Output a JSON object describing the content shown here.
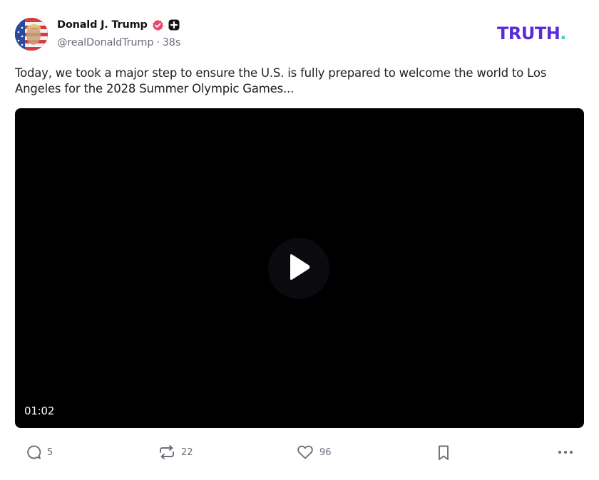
{
  "post": {
    "author": {
      "display_name": "Donald J. Trump",
      "handle": "@realDonaldTrump",
      "time_ago": "38s",
      "separator": "·"
    },
    "brand": {
      "logo_text": "TRUTH",
      "logo_dot": ".",
      "colors": {
        "primary": "#5a2bd6",
        "accent": "#3fd0c9"
      }
    },
    "text": "Today, we took a major step to ensure the U.S. is fully prepared to welcome the world to Los Angeles for the 2028 Summer Olympic Games...",
    "video": {
      "duration": "01:02",
      "play_icon": "play-icon"
    },
    "actions": {
      "replies": "5",
      "retruths": "22",
      "likes": "96"
    },
    "icons": {
      "verified": "verified-badge-icon",
      "plus": "plus-badge-icon",
      "reply": "comment-icon",
      "retruth": "repost-icon",
      "like": "heart-icon",
      "bookmark": "bookmark-icon",
      "more": "more-dots-icon"
    }
  }
}
